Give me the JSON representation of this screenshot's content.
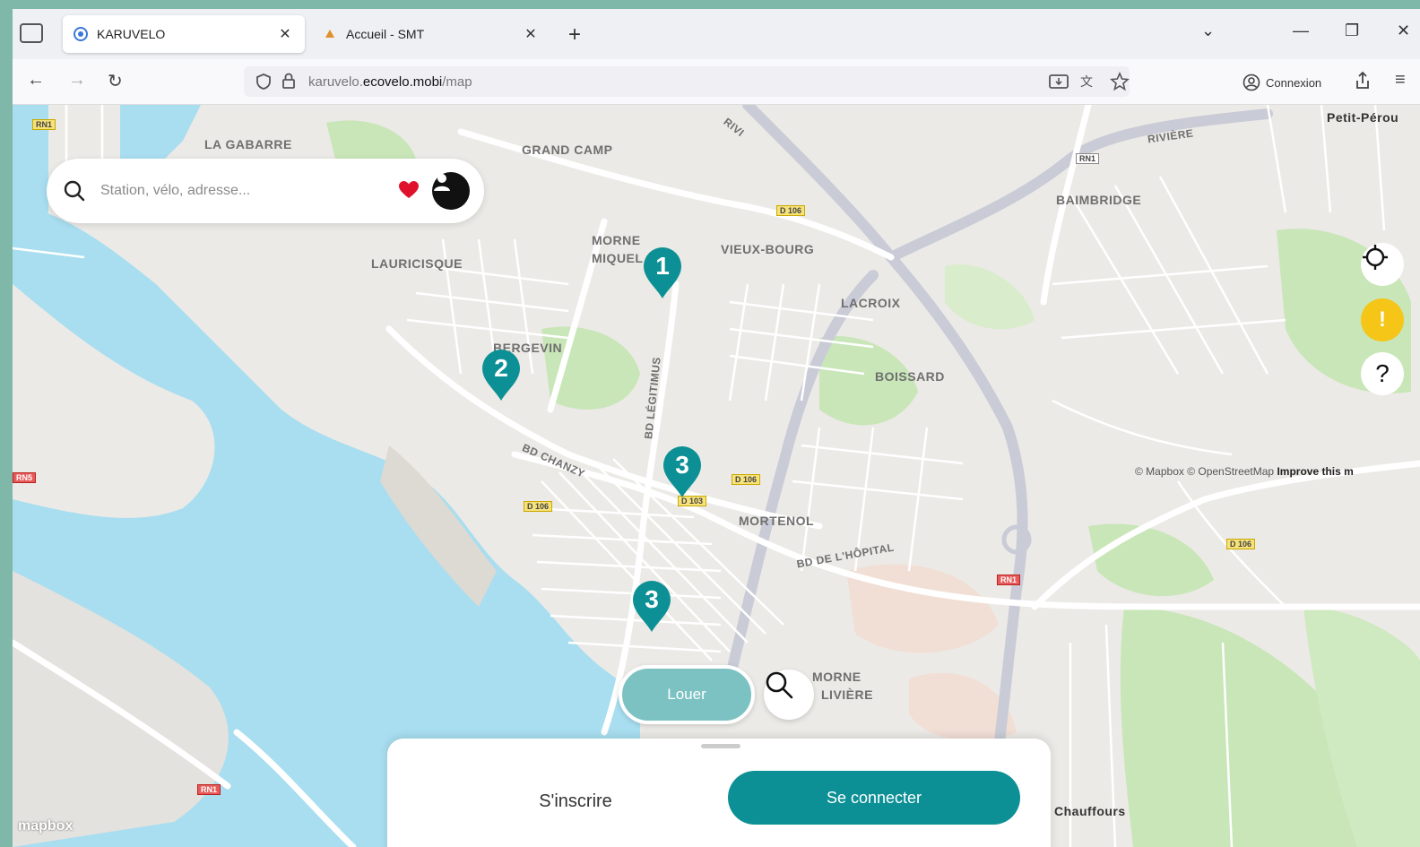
{
  "browser": {
    "tabs": [
      {
        "title": "KARUVELO",
        "active": true
      },
      {
        "title": "Accueil - SMT",
        "active": false
      }
    ],
    "url_prefix": "karuvelo.",
    "url_domain": "ecovelo.mobi",
    "url_path": "/map",
    "connexion_label": "Connexion"
  },
  "search": {
    "placeholder": "Station, vélo, adresse..."
  },
  "map_labels": {
    "la_gabarre": "LA GABARRE",
    "grand_camp": "GRAND CAMP",
    "petit_perou": "Petit-Pérou",
    "baimbridge": "BAIMBRIDGE",
    "morne_miquel_1": "MORNE",
    "morne_miquel_2": "MIQUEL",
    "vieux_bourg": "VIEUX-BOURG",
    "lauricisque": "LAURICISQUE",
    "lacroix": "LACROIX",
    "bergevin": "BERGEVIN",
    "boissard": "BOISSARD",
    "bd_legitimus": "BD LÉGITIMUS",
    "bd_chanzy": "BD CHANZY",
    "mortenol": "MORTENOL",
    "bd_hopital": "BD DE L'HÔPITAL",
    "morne_liviere_1": "MORNE",
    "morne_liviere_2": "LIVIÈRE",
    "chauffours": "Chauffours",
    "rivi": "RIVI",
    "jacques": "RIVIÈRE"
  },
  "road_shields": {
    "s1": "RN1",
    "s2": "D 106",
    "s3": "RN1",
    "s4": "D 106",
    "s5": "D 103",
    "s6": "D 106",
    "s7": "RN5",
    "s8": "RN1",
    "s9": "D 106",
    "s10": "RN1"
  },
  "markers": [
    {
      "label": "1"
    },
    {
      "label": "2"
    },
    {
      "label": "3"
    },
    {
      "label": "3"
    }
  ],
  "attribution": {
    "text": "© Mapbox © OpenStreetMap",
    "improve": "Improve this m"
  },
  "controls": {
    "help": "?",
    "alert": "!"
  },
  "locate_label": "Louer",
  "sheet": {
    "signup_label": "S'inscrire",
    "login_label": "Se connecter"
  },
  "mapbox_logo": "mapbox",
  "colors": {
    "teal": "#0d9095",
    "water": "#a8def0",
    "park": "#c8e6b8",
    "alert": "#f5c518"
  }
}
